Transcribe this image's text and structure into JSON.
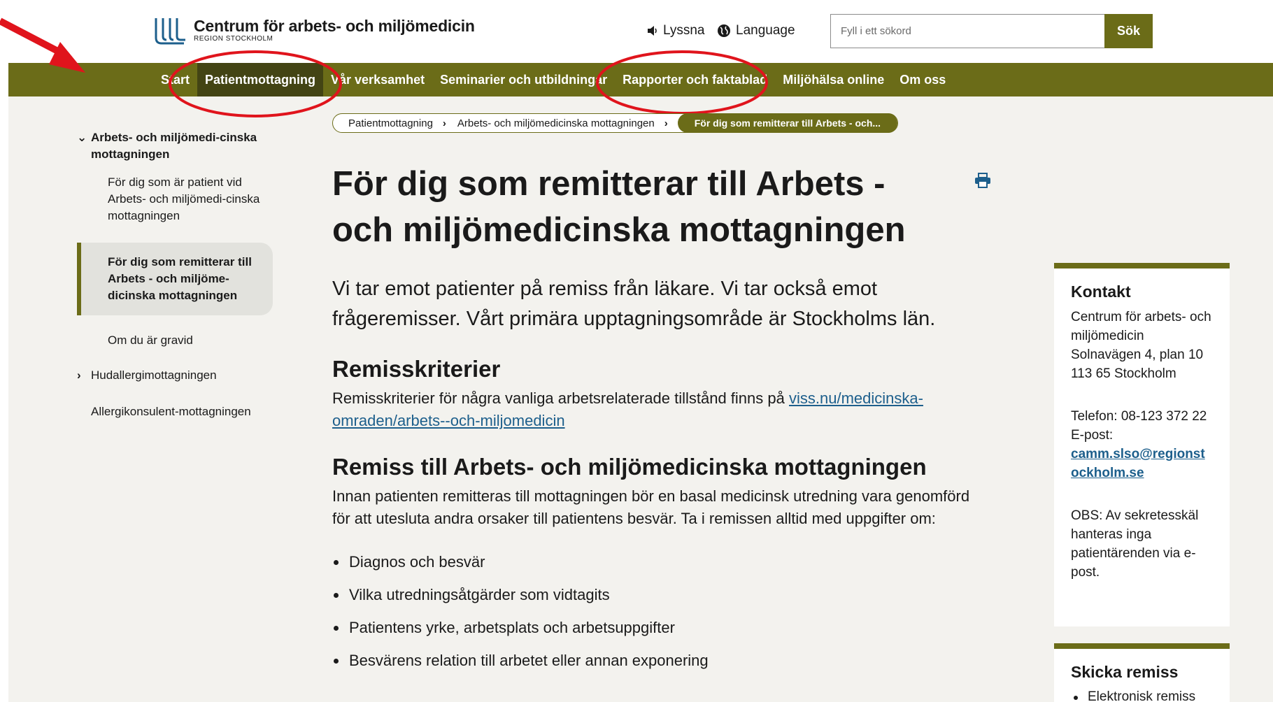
{
  "header": {
    "logo_title": "Centrum för arbets- och miljömedicin",
    "logo_subtitle": "REGION STOCKHOLM",
    "listen_label": "Lyssna",
    "language_label": "Language",
    "search_placeholder": "Fyll i ett sökord",
    "search_button": "Sök"
  },
  "nav": {
    "items": [
      {
        "label": "Start",
        "icon": ""
      },
      {
        "label": "Patientmottagning",
        "active": true
      },
      {
        "label": "Vår verksamhet"
      },
      {
        "label": "Seminarier och utbildningar"
      },
      {
        "label": "Rapporter och faktablad"
      },
      {
        "label": "Miljöhälsa online"
      },
      {
        "label": "Om oss"
      }
    ]
  },
  "breadcrumb": {
    "items": [
      "Patientmottagning",
      "Arbets- och miljömedicinska mottagningen"
    ],
    "current": "För dig som remitterar till Arbets - och..."
  },
  "sidebar": {
    "section": "Arbets- och miljömedi-cinska mottagningen",
    "items": [
      "För dig som är patient vid Arbets- och miljömedi-cinska mottagningen",
      "För dig som remitterar till Arbets - och miljöme-dicinska mottagningen",
      "Om du är gravid"
    ],
    "other_1": "Hudallergimottagningen",
    "other_2": "Allergikonsulent-mottagningen"
  },
  "main": {
    "title": "För dig som remitterar till Arbets - och miljömedicinska mottagningen",
    "lead": "Vi tar emot patienter på remiss från läkare. Vi tar också emot frågeremisser. Vårt primära upptagningsområde är Stockholms län.",
    "section1_heading": "Remisskriterier",
    "section1_text": "Remisskriterier för några vanliga arbetsrelaterade tillstånd finns på",
    "section1_link": "viss.nu/medicinska-omraden/arbets--och-miljomedicin",
    "section2_heading": "Remiss till Arbets- och miljömedicinska mottagningen",
    "section2_text": "Innan patienten remitteras till mottagningen bör en basal medicinsk utredning vara genomförd för att utesluta andra orsaker till patientens besvär. Ta i remissen alltid med uppgifter om:",
    "bullets": [
      "Diagnos och besvär",
      "Vilka utredningsåtgärder som vidtagits",
      "Patientens yrke, arbetsplats och arbetsuppgifter",
      "Besvärens relation till arbetet eller annan exponering"
    ]
  },
  "contact": {
    "title": "Kontakt",
    "org": "Centrum för arbets- och miljömedicin",
    "address": "Solnavägen 4, plan 10",
    "postal": "113 65 Stockholm",
    "phone": "Telefon: 08-123 372 22",
    "email_label": "E-post:",
    "email": "camm.slso@regionstockholm.se",
    "note": "OBS: Av sekretesskäl hanteras inga patientärenden via e-post."
  },
  "remiss": {
    "title": "Skicka remiss",
    "items": [
      "Elektronisk remiss"
    ]
  },
  "colors": {
    "brand_olive": "#6b6c18",
    "nav_active": "#434414",
    "link": "#1d5f8c",
    "annotation": "#e0141c"
  }
}
